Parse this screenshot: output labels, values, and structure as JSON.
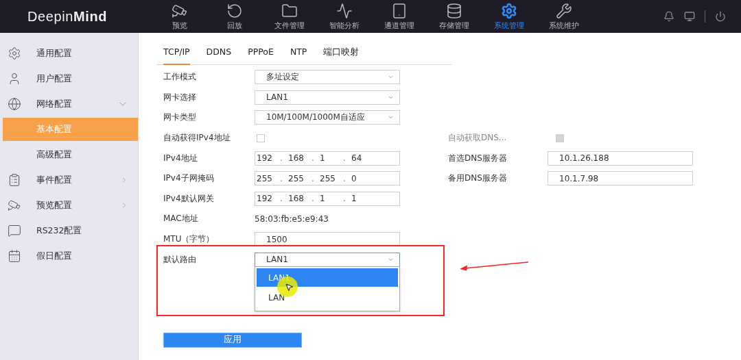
{
  "header": {
    "logo": "Deepin**Mind**",
    "nav": [
      {
        "label": "预览",
        "selected": false
      },
      {
        "label": "回放",
        "selected": false
      },
      {
        "label": "文件管理",
        "selected": false
      },
      {
        "label": "智能分析",
        "selected": false
      },
      {
        "label": "通道管理",
        "selected": false
      },
      {
        "label": "存储管理",
        "selected": false
      },
      {
        "label": "系统管理",
        "selected": true
      },
      {
        "label": "系统维护",
        "selected": false
      }
    ]
  },
  "sidebar": {
    "items": [
      {
        "label": "通用配置",
        "selected": false
      },
      {
        "label": "用户配置",
        "selected": false
      },
      {
        "label": "网络配置",
        "expanded": true,
        "selected": false,
        "children": [
          {
            "label": "基本配置",
            "selected": true
          },
          {
            "label": "高级配置",
            "selected": false
          }
        ]
      },
      {
        "label": "事件配置",
        "expanded": false,
        "selected": false
      },
      {
        "label": "预览配置",
        "expanded": false,
        "selected": false
      },
      {
        "label": "RS232配置",
        "selected": false
      },
      {
        "label": "假日配置",
        "selected": false
      }
    ]
  },
  "tabs": [
    {
      "label": "TCP/IP",
      "selected": true
    },
    {
      "label": "DDNS",
      "selected": false
    },
    {
      "label": "PPPoE",
      "selected": false
    },
    {
      "label": "NTP",
      "selected": false
    },
    {
      "label": "端口映射",
      "selected": false
    }
  ],
  "form": {
    "left": [
      {
        "label": "工作模式",
        "kind": "select",
        "value": "多址设定"
      },
      {
        "label": "网卡选择",
        "kind": "select",
        "value": "LAN1"
      },
      {
        "label": "网卡类型",
        "kind": "select",
        "value": "10M/100M/1000M自适应"
      },
      {
        "label": "自动获得IPv4地址",
        "kind": "checkbox",
        "checked": false,
        "disabled": false
      },
      {
        "label": "IPv4地址",
        "kind": "ip",
        "parts": [
          "192",
          "168",
          "1",
          "64"
        ]
      },
      {
        "label": "IPv4子网掩码",
        "kind": "ip",
        "parts": [
          "255",
          "255",
          "255",
          "0"
        ]
      },
      {
        "label": "IPv4默认网关",
        "kind": "ip",
        "parts": [
          "192",
          "168",
          "1",
          "1"
        ]
      },
      {
        "label": "MAC地址",
        "kind": "static",
        "value": "58:03:fb:e5:e9:43"
      },
      {
        "label": "MTU（字节）",
        "kind": "text",
        "value": "1500"
      },
      {
        "label": "默认路由",
        "kind": "select",
        "value": "LAN1",
        "expanded": true,
        "options": [
          {
            "label": "LAN1",
            "selected": true
          },
          {
            "label": "LAN",
            "selected": false
          }
        ]
      }
    ],
    "right": [
      {
        "label": "自动获取DNS...",
        "kind": "checkbox",
        "disabled": true
      },
      {
        "label": "首选DNS服务器",
        "kind": "text",
        "value": "10.1.26.188"
      },
      {
        "label": "备用DNS服务器",
        "kind": "text",
        "value": "10.1.7.98"
      }
    ],
    "ip_separator": "."
  },
  "apply_button": "应用"
}
